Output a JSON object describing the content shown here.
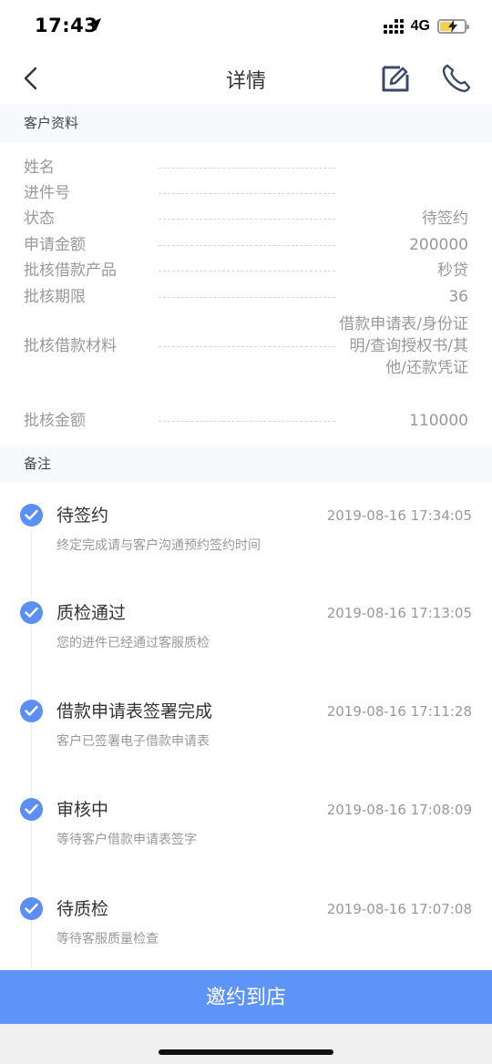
{
  "status_bar": {
    "time": "17:43",
    "network": "4G"
  },
  "nav": {
    "title": "详情",
    "back_icon": "chevron-left-icon",
    "edit_icon": "edit-icon",
    "phone_icon": "phone-icon"
  },
  "customer_section": {
    "title": "客户资料",
    "rows": [
      {
        "label": "姓名",
        "value": ""
      },
      {
        "label": "进件号",
        "value": ""
      },
      {
        "label": "状态",
        "value": "待签约"
      },
      {
        "label": "申请金额",
        "value": "200000"
      },
      {
        "label": "批核借款产品",
        "value": "秒贷"
      },
      {
        "label": "批核期限",
        "value": "36"
      },
      {
        "label": "批核借款材料",
        "value": "借款申请表/身份证明/查询授权书/其他/还款凭证"
      },
      {
        "label": "批核金额",
        "value": "110000"
      }
    ]
  },
  "remarks_section": {
    "title": "备注"
  },
  "timeline": [
    {
      "title": "待签约",
      "time": "2019-08-16 17:34:05",
      "desc": "终定完成请与客户沟通预约签约时间"
    },
    {
      "title": "质检通过",
      "time": "2019-08-16 17:13:05",
      "desc": "您的进件已经通过客服质检"
    },
    {
      "title": "借款申请表签署完成",
      "time": "2019-08-16 17:11:28",
      "desc": "客户已签署电子借款申请表"
    },
    {
      "title": "审核中",
      "time": "2019-08-16 17:08:09",
      "desc": "等待客户借款申请表签字"
    },
    {
      "title": "待质检",
      "time": "2019-08-16 17:07:08",
      "desc": "等待客服质量检查"
    }
  ],
  "bottom_button": {
    "label": "邀约到店"
  },
  "colors": {
    "accent": "#5e93f7",
    "check": "#5b8ff6",
    "section_bg": "#f7f9fc"
  }
}
